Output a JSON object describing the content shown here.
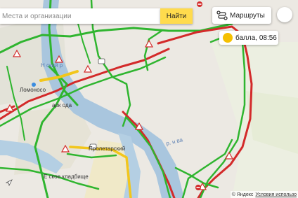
{
  "search": {
    "placeholder": "Места и организации",
    "button_label": "Найти"
  },
  "routes": {
    "label": "Маршруты"
  },
  "traffic": {
    "level": "",
    "label": "балла, 08:56"
  },
  "map_labels": {
    "district": "Н ский р",
    "lomonosov": "Ломоносо",
    "park": "арк ода",
    "proletarsky": "Пролетарский",
    "cemetery": "Е ское кладбище",
    "river": "р. н ва"
  },
  "footer": {
    "copyright": "© Яндекс",
    "terms": "Условия использо"
  },
  "colors": {
    "jam_green": "#2fb52f",
    "jam_red": "#d32a2a",
    "jam_yellow": "#f2c61b",
    "river": "#a9c6de",
    "accent": "#ffdb4d"
  }
}
